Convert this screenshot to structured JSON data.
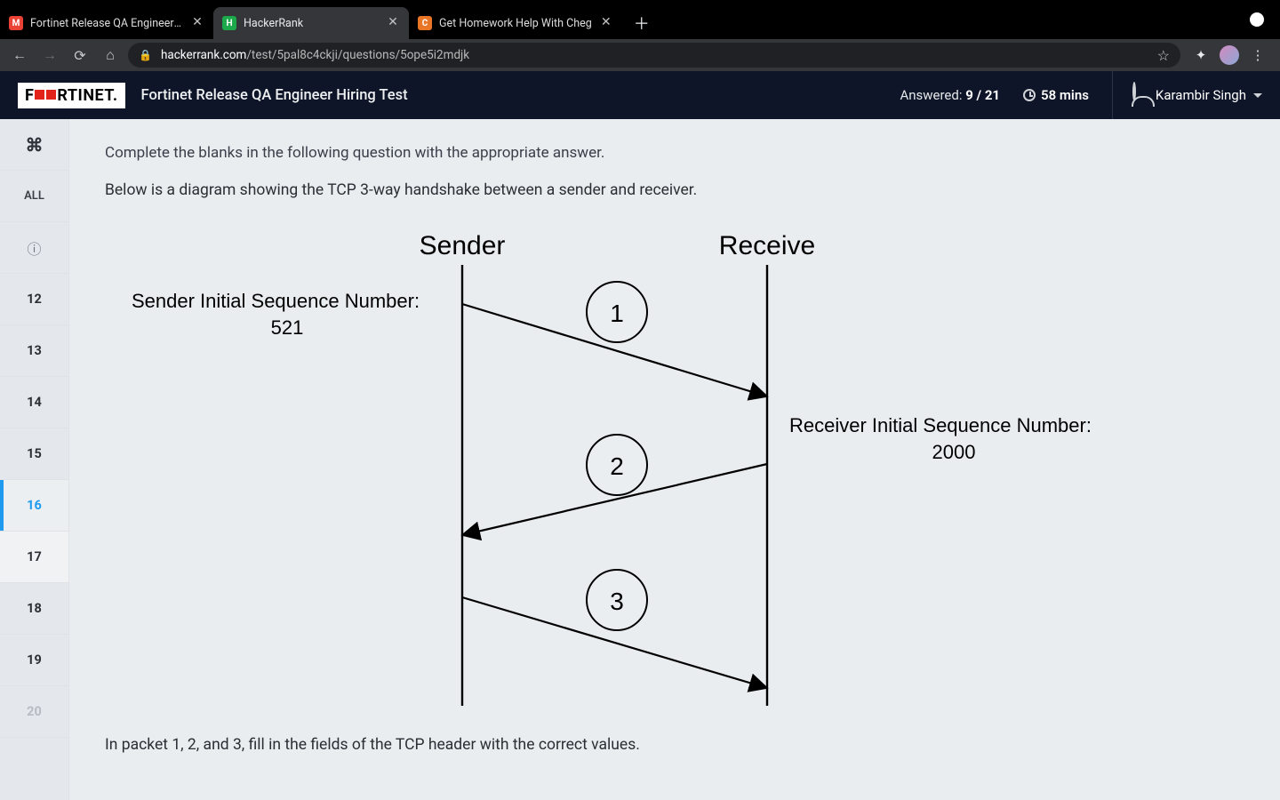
{
  "browser": {
    "tabs": [
      {
        "title": "Fortinet Release QA Engineer H",
        "favicon_bg": "#ea4335",
        "favicon_text": "M"
      },
      {
        "title": "HackerRank",
        "favicon_bg": "#1ba94c",
        "favicon_text": "H"
      },
      {
        "title": "Get Homework Help With Cheg",
        "favicon_bg": "#e97627",
        "favicon_text": "C"
      }
    ],
    "url_host": "hackerrank.com",
    "url_rest": "/test/5pal8c4ckji/questions/5ope5i2mdjk"
  },
  "topbar": {
    "brand": "F  RTINET",
    "test_title": "Fortinet Release QA Engineer Hiring Test",
    "answered_label": "Answered: ",
    "answered_value": "9 / 21",
    "timer_value": "58 mins",
    "user_name": "Karambir Singh"
  },
  "sidebar": {
    "cmd_icon": "⌘",
    "all_label": "ALL",
    "info_icon": "ⓘ",
    "questions": [
      "12",
      "13",
      "14",
      "15",
      "16",
      "17",
      "18",
      "19",
      "20"
    ],
    "active_index": 4
  },
  "question": {
    "instruction": "Complete the blanks in the following question with the appropriate answer.",
    "description": "Below is a diagram showing the TCP 3-way handshake between a sender and receiver.",
    "followup": "In packet 1, 2, and 3, fill in the fields of the TCP header with the correct values."
  },
  "chart_data": {
    "type": "sequence-diagram",
    "lifelines": [
      "Sender",
      "Receive"
    ],
    "sender_isn_label": "Sender Initial Sequence Number:",
    "sender_isn_value": "521",
    "receiver_isn_label": "Receiver Initial Sequence Number:",
    "receiver_isn_value": "2000",
    "messages": [
      {
        "n": "1",
        "from": "Sender",
        "to": "Receive"
      },
      {
        "n": "2",
        "from": "Receive",
        "to": "Sender"
      },
      {
        "n": "3",
        "from": "Sender",
        "to": "Receive"
      }
    ]
  }
}
